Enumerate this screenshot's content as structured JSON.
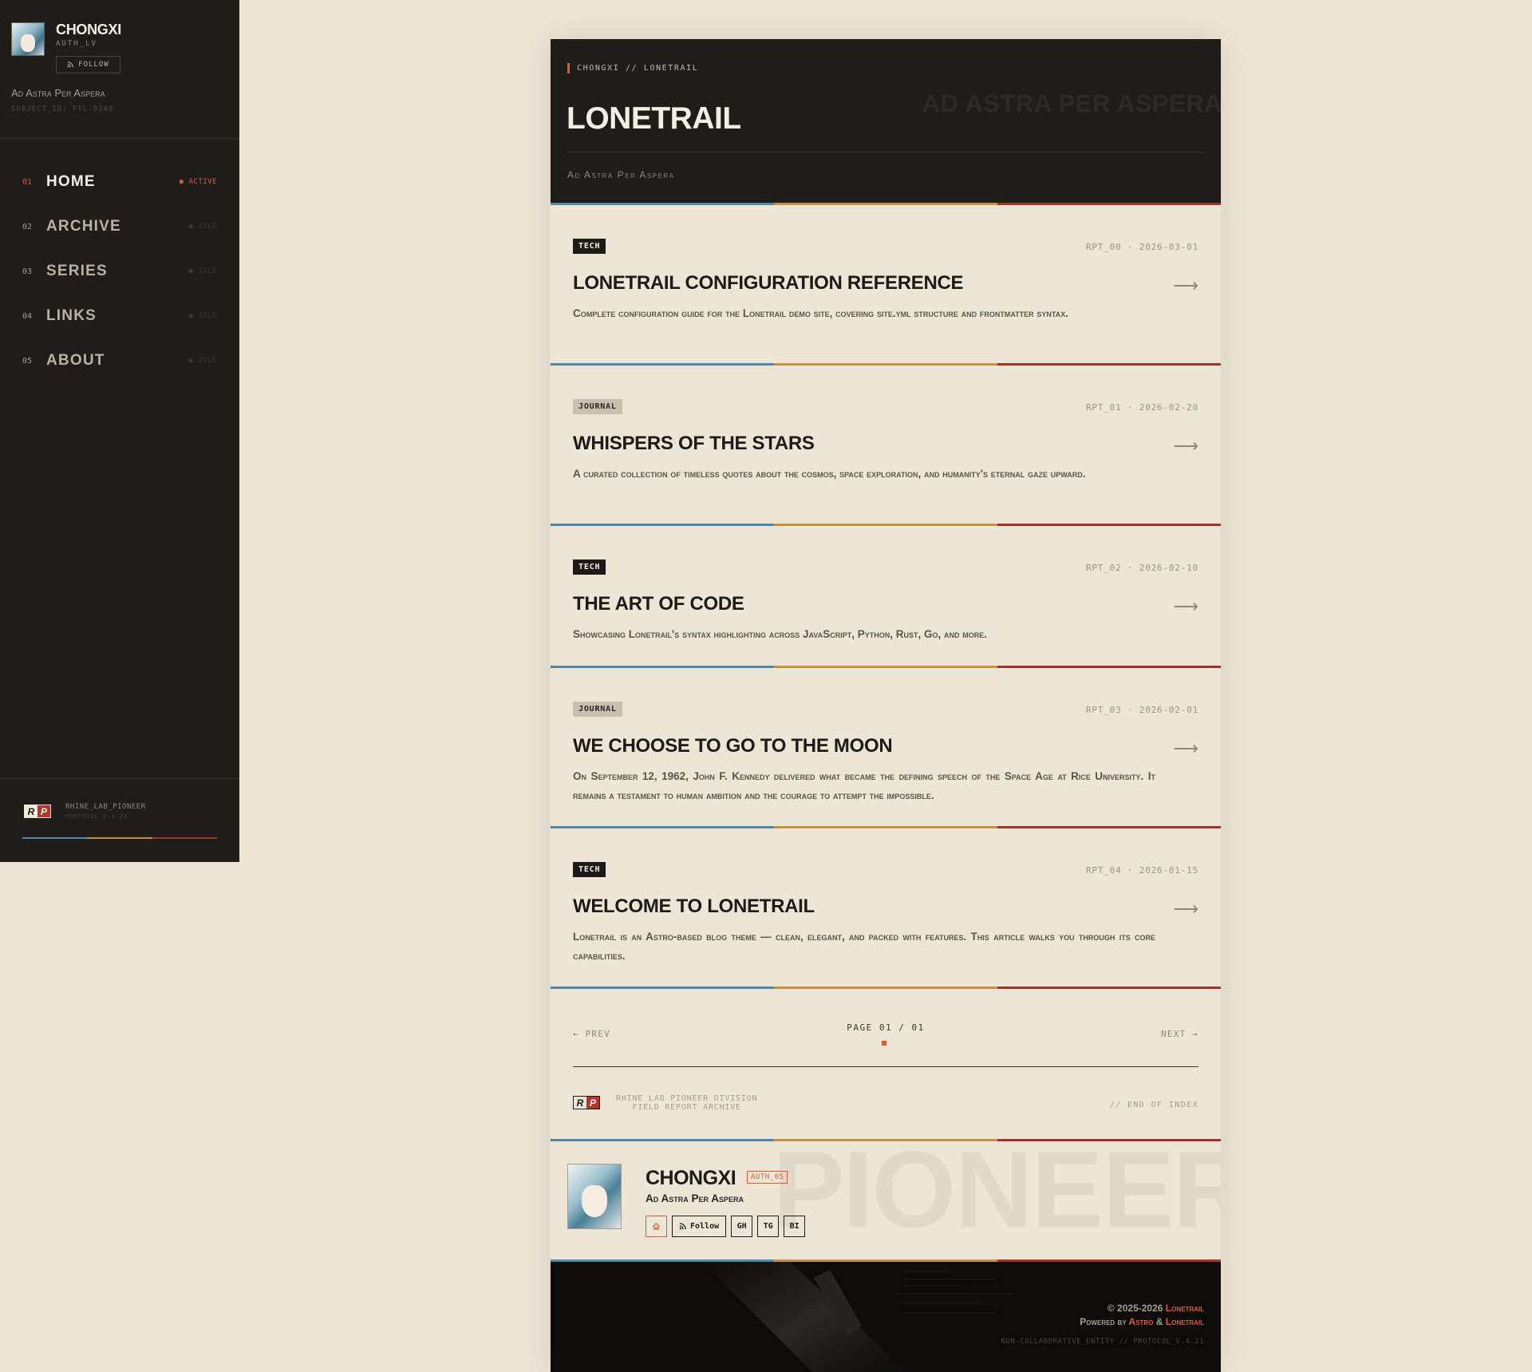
{
  "sidebar": {
    "name": "CHONGXI",
    "role": "AUTH_LV",
    "follow_label": "FOLLOW",
    "motto": "Ad Astra Per Aspera",
    "subject": "SUBJECT_ID: FTL-9348",
    "nav": [
      {
        "num": "01",
        "label": "HOME",
        "status": "● ACTIVE",
        "active": true
      },
      {
        "num": "02",
        "label": "ARCHIVE",
        "status": "● IDLE",
        "active": false
      },
      {
        "num": "03",
        "label": "SERIES",
        "status": "● IDLE",
        "active": false
      },
      {
        "num": "04",
        "label": "LINKS",
        "status": "● IDLE",
        "active": false
      },
      {
        "num": "05",
        "label": "ABOUT",
        "status": "● IDLE",
        "active": false
      }
    ],
    "footer_title": "RHINE_LAB_PIONEER",
    "footer_sub": "PROTOCOL_V.4.21"
  },
  "header": {
    "breadcrumb": "CHONGXI // LONETRAIL",
    "title": "LONETRAIL",
    "ghost": "AD ASTRA PER ASPERA",
    "subtitle": "Ad Astra Per Aspera"
  },
  "posts": [
    {
      "tag": "TECH",
      "tag_kind": "tech",
      "meta": "RPT_00 · 2026-03-01",
      "title": "LONETRAIL CONFIGURATION REFERENCE",
      "desc": "Complete configuration guide for the Lonetrail demo site, covering site.yml structure and frontmatter syntax."
    },
    {
      "tag": "JOURNAL",
      "tag_kind": "journal",
      "meta": "RPT_01 · 2026-02-20",
      "title": "WHISPERS OF THE STARS",
      "desc": "A curated collection of timeless quotes about the cosmos, space exploration, and humanity's eternal gaze upward."
    },
    {
      "tag": "TECH",
      "tag_kind": "tech",
      "meta": "RPT_02 · 2026-02-10",
      "title": "THE ART OF CODE",
      "desc": "Showcasing Lonetrail's syntax highlighting across JavaScript, Python, Rust, Go, and more."
    },
    {
      "tag": "JOURNAL",
      "tag_kind": "journal",
      "meta": "RPT_03 · 2026-02-01",
      "title": "WE CHOOSE TO GO TO THE MOON",
      "desc": "On September 12, 1962, John F. Kennedy delivered what became the defining speech of the Space Age at Rice University. It remains a testament to human ambition and the courage to attempt the impossible."
    },
    {
      "tag": "TECH",
      "tag_kind": "tech",
      "meta": "RPT_04 · 2026-01-15",
      "title": "WELCOME TO LONETRAIL",
      "desc": "Lonetrail is an Astro-based blog theme — clean, elegant, and packed with features. This article walks you through its core capabilities."
    }
  ],
  "pager": {
    "prev": "← PREV",
    "next": "NEXT →",
    "indicator": "PAGE 01 / 01"
  },
  "footnote": {
    "line1": "RHINE LAB PIONEER DIVISION",
    "line2": "FIELD REPORT ARCHIVE",
    "end": "// END OF INDEX"
  },
  "author": {
    "ghost": "PIONEER",
    "name": "CHONGXI",
    "badge": "AUTH_05",
    "motto": "Ad Astra Per Aspera",
    "follow_label": "Follow",
    "links": [
      "GH",
      "TG",
      "BI"
    ]
  },
  "footer": {
    "copyright_prefix": "© 2025-2026 ",
    "copyright_brand": "Lonetrail",
    "powered_prefix": "Powered by ",
    "powered_astro": "Astro",
    "powered_amp": " & ",
    "powered_brand": "Lonetrail",
    "protocol": "NON-COLLABORATIVE_ENTITY // PROTOCOL_V.4.21"
  },
  "colors": {
    "accent": "#e4572e",
    "stripe_blue": "#4e8aa8",
    "stripe_gold": "#c78f3e",
    "stripe_red": "#a2322c",
    "sidebar_bg": "#1f1d1a",
    "page_bg": "#ede5d6"
  },
  "icons": {
    "follow": "rss-icon",
    "home": "home-icon",
    "arrow": "arrow-right-icon"
  }
}
